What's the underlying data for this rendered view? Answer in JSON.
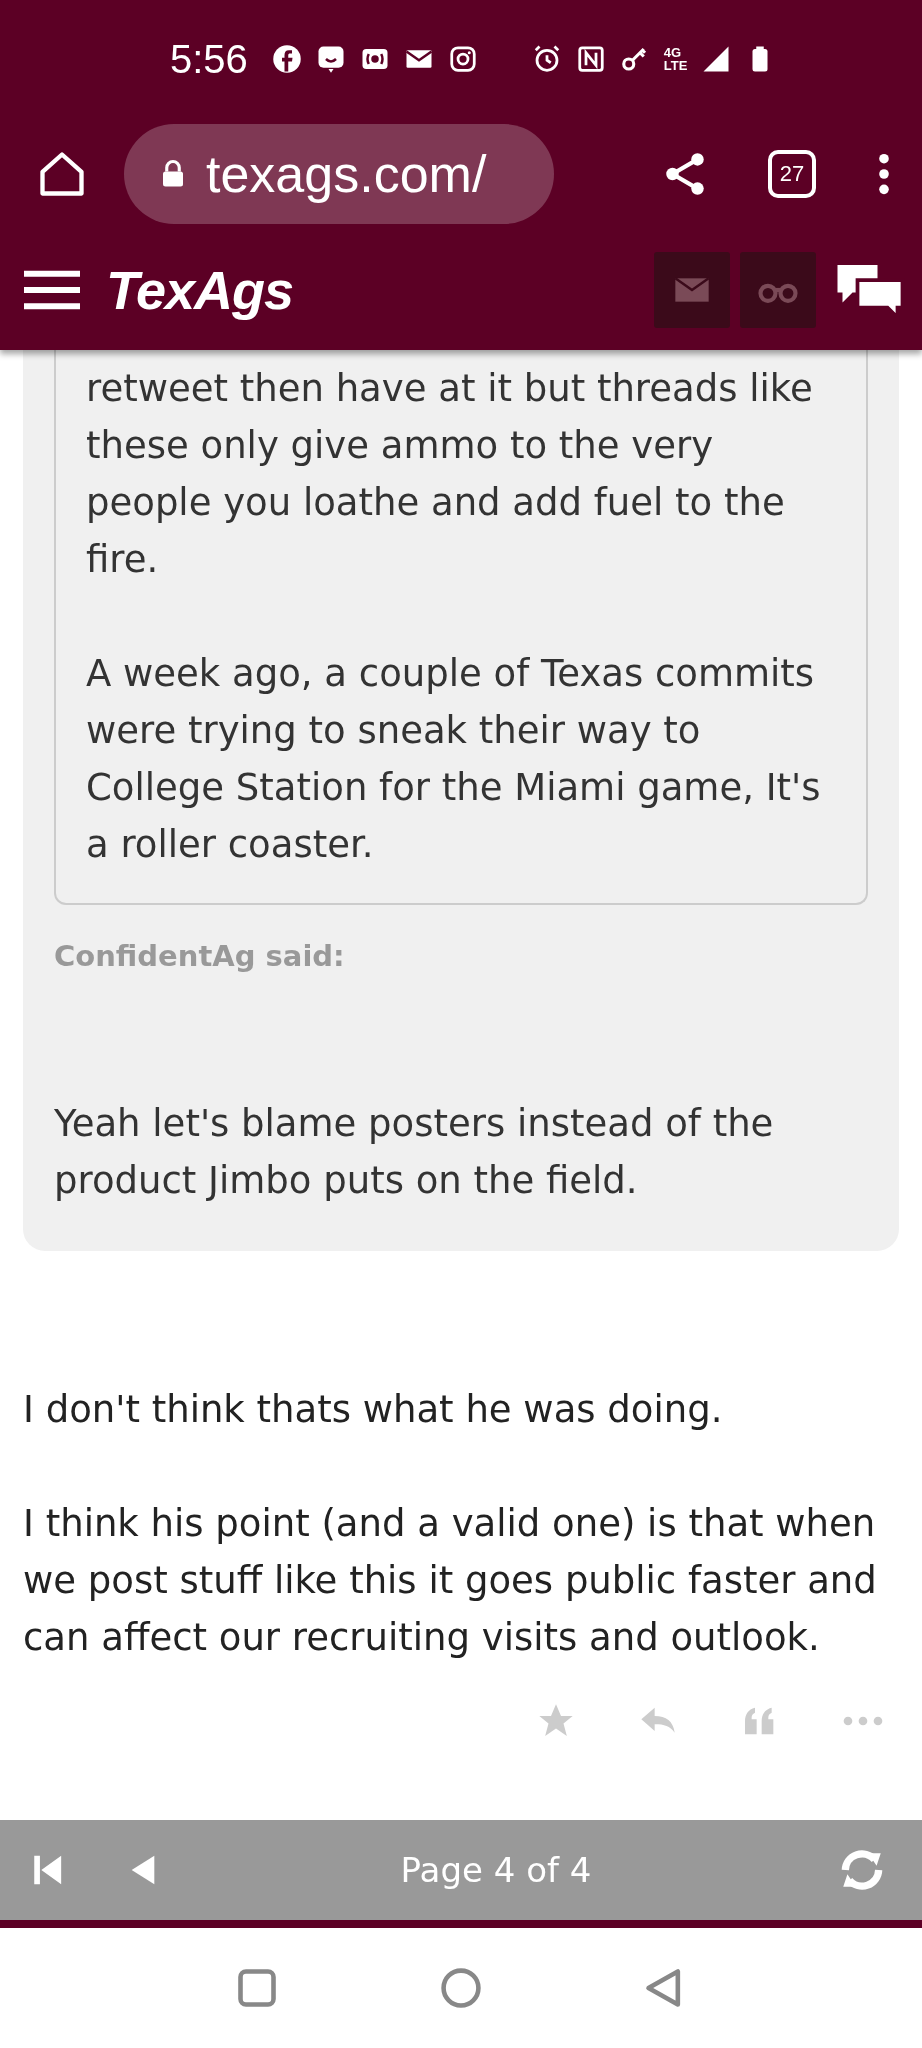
{
  "status_bar": {
    "time": "5:56",
    "network_top": "4G",
    "network_bottom": "LTE"
  },
  "browser": {
    "url": "texags.com/",
    "tab_count": "27"
  },
  "site_header": {
    "logo": "TexAgs"
  },
  "post": {
    "quote": {
      "nested_quote_paragraphs": [
        "retweet then have at it but threads like these only give ammo to the very people you loathe and add fuel to the fire.",
        "A week ago, a couple of Texas commits were trying to sneak their way to College Station for the Miami game, It's a roller coaster."
      ],
      "author": "ConfidentAg said:",
      "text": "Yeah let's blame posters instead of the product Jimbo puts on the field."
    },
    "paragraphs": [
      "I don't think thats what he was doing.",
      "I think his point (and a valid one) is that when we post stuff like this it goes public faster and can affect our recruiting visits and outlook."
    ]
  },
  "pager": {
    "label": "Page 4 of 4"
  }
}
